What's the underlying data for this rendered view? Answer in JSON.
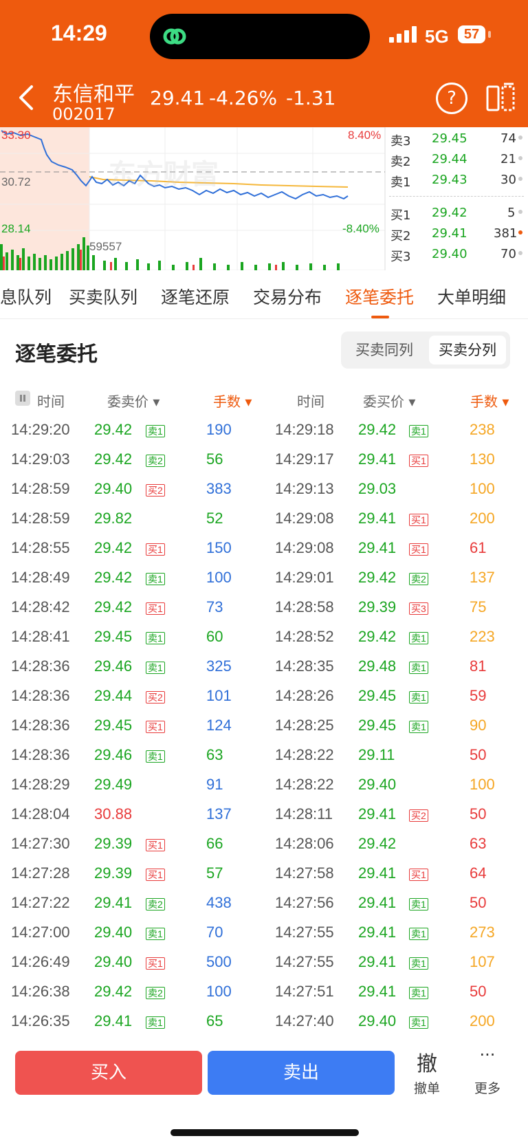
{
  "status": {
    "time": "14:29",
    "network": "5G",
    "battery": "57"
  },
  "stock": {
    "name": "东信和平",
    "code": "002017",
    "price": "29.41",
    "pct": "-4.26%",
    "change": "-1.31"
  },
  "chart": {
    "high": "33.30",
    "mid": "30.72",
    "low": "28.14",
    "up_pct": "8.40%",
    "down_pct": "-8.40%",
    "volume": "59557",
    "watermark": "东方财富"
  },
  "orderbook": {
    "sell": [
      {
        "label": "卖3",
        "price": "29.45",
        "vol": "74"
      },
      {
        "label": "卖2",
        "price": "29.44",
        "vol": "21"
      },
      {
        "label": "卖1",
        "price": "29.43",
        "vol": "30"
      }
    ],
    "buy": [
      {
        "label": "买1",
        "price": "29.42",
        "vol": "5"
      },
      {
        "label": "买2",
        "price": "29.41",
        "vol": "381"
      },
      {
        "label": "买3",
        "price": "29.40",
        "vol": "70"
      }
    ]
  },
  "tabs": [
    "息队列",
    "买卖队列",
    "逐笔还原",
    "交易分布",
    "逐笔委托",
    "大单明细"
  ],
  "section": {
    "title": "逐笔委托",
    "seg_same": "买卖同列",
    "seg_split": "买卖分列"
  },
  "headers": {
    "time1": "时间",
    "sell_price": "委卖价",
    "lots1": "手数",
    "time2": "时间",
    "buy_price": "委买价",
    "lots2": "手数"
  },
  "rows": [
    {
      "lt": "14:29:20",
      "lp": "29.42",
      "lpc": "g",
      "lg": "卖1",
      "lgc": "g",
      "lv": "190",
      "rt": "14:29:18",
      "rp": "29.42",
      "rpc": "g",
      "rg": "卖1",
      "rgc": "g",
      "rv": "238",
      "rvc": "o"
    },
    {
      "lt": "14:29:03",
      "lp": "29.42",
      "lpc": "g",
      "lg": "卖2",
      "lgc": "g",
      "lv": "56",
      "lvc": "g",
      "rt": "14:29:17",
      "rp": "29.41",
      "rpc": "g",
      "rg": "买1",
      "rgc": "r",
      "rv": "130",
      "rvc": "o"
    },
    {
      "lt": "14:28:59",
      "lp": "29.40",
      "lpc": "g",
      "lg": "买2",
      "lgc": "r",
      "lv": "383",
      "rt": "14:29:13",
      "rp": "29.03",
      "rpc": "g",
      "rg": "",
      "rgc": "",
      "rv": "100",
      "rvc": "o"
    },
    {
      "lt": "14:28:59",
      "lp": "29.82",
      "lpc": "g",
      "lg": "",
      "lgc": "",
      "lv": "52",
      "lvc": "g",
      "rt": "14:29:08",
      "rp": "29.41",
      "rpc": "g",
      "rg": "买1",
      "rgc": "r",
      "rv": "200",
      "rvc": "o"
    },
    {
      "lt": "14:28:55",
      "lp": "29.42",
      "lpc": "g",
      "lg": "买1",
      "lgc": "r",
      "lv": "150",
      "rt": "14:29:08",
      "rp": "29.41",
      "rpc": "g",
      "rg": "买1",
      "rgc": "r",
      "rv": "61",
      "rvc": "r"
    },
    {
      "lt": "14:28:49",
      "lp": "29.42",
      "lpc": "g",
      "lg": "卖1",
      "lgc": "g",
      "lv": "100",
      "rt": "14:29:01",
      "rp": "29.42",
      "rpc": "g",
      "rg": "卖2",
      "rgc": "g",
      "rv": "137",
      "rvc": "o"
    },
    {
      "lt": "14:28:42",
      "lp": "29.42",
      "lpc": "g",
      "lg": "买1",
      "lgc": "r",
      "lv": "73",
      "rt": "14:28:58",
      "rp": "29.39",
      "rpc": "g",
      "rg": "买3",
      "rgc": "r",
      "rv": "75",
      "rvc": "o"
    },
    {
      "lt": "14:28:41",
      "lp": "29.45",
      "lpc": "g",
      "lg": "卖1",
      "lgc": "g",
      "lv": "60",
      "lvc": "g",
      "rt": "14:28:52",
      "rp": "29.42",
      "rpc": "g",
      "rg": "卖1",
      "rgc": "g",
      "rv": "223",
      "rvc": "o"
    },
    {
      "lt": "14:28:36",
      "lp": "29.46",
      "lpc": "g",
      "lg": "卖1",
      "lgc": "g",
      "lv": "325",
      "rt": "14:28:35",
      "rp": "29.48",
      "rpc": "g",
      "rg": "卖1",
      "rgc": "g",
      "rv": "81",
      "rvc": "r"
    },
    {
      "lt": "14:28:36",
      "lp": "29.44",
      "lpc": "g",
      "lg": "买2",
      "lgc": "r",
      "lv": "101",
      "rt": "14:28:26",
      "rp": "29.45",
      "rpc": "g",
      "rg": "卖1",
      "rgc": "g",
      "rv": "59",
      "rvc": "r"
    },
    {
      "lt": "14:28:36",
      "lp": "29.45",
      "lpc": "g",
      "lg": "买1",
      "lgc": "r",
      "lv": "124",
      "rt": "14:28:25",
      "rp": "29.45",
      "rpc": "g",
      "rg": "卖1",
      "rgc": "g",
      "rv": "90",
      "rvc": "o"
    },
    {
      "lt": "14:28:36",
      "lp": "29.46",
      "lpc": "g",
      "lg": "卖1",
      "lgc": "g",
      "lv": "63",
      "lvc": "g",
      "rt": "14:28:22",
      "rp": "29.11",
      "rpc": "g",
      "rg": "",
      "rgc": "",
      "rv": "50",
      "rvc": "r"
    },
    {
      "lt": "14:28:29",
      "lp": "29.49",
      "lpc": "g",
      "lg": "",
      "lgc": "",
      "lv": "91",
      "rt": "14:28:22",
      "rp": "29.40",
      "rpc": "g",
      "rg": "",
      "rgc": "",
      "rv": "100",
      "rvc": "o"
    },
    {
      "lt": "14:28:04",
      "lp": "30.88",
      "lpc": "r",
      "lg": "",
      "lgc": "",
      "lv": "137",
      "rt": "14:28:11",
      "rp": "29.41",
      "rpc": "g",
      "rg": "买2",
      "rgc": "r",
      "rv": "50",
      "rvc": "r"
    },
    {
      "lt": "14:27:30",
      "lp": "29.39",
      "lpc": "g",
      "lg": "买1",
      "lgc": "r",
      "lv": "66",
      "lvc": "g",
      "rt": "14:28:06",
      "rp": "29.42",
      "rpc": "g",
      "rg": "",
      "rgc": "",
      "rv": "63",
      "rvc": "r"
    },
    {
      "lt": "14:27:28",
      "lp": "29.39",
      "lpc": "g",
      "lg": "买1",
      "lgc": "r",
      "lv": "57",
      "lvc": "g",
      "rt": "14:27:58",
      "rp": "29.41",
      "rpc": "g",
      "rg": "买1",
      "rgc": "r",
      "rv": "64",
      "rvc": "r"
    },
    {
      "lt": "14:27:22",
      "lp": "29.41",
      "lpc": "g",
      "lg": "卖2",
      "lgc": "g",
      "lv": "438",
      "rt": "14:27:56",
      "rp": "29.41",
      "rpc": "g",
      "rg": "卖1",
      "rgc": "g",
      "rv": "50",
      "rvc": "r"
    },
    {
      "lt": "14:27:00",
      "lp": "29.40",
      "lpc": "g",
      "lg": "卖1",
      "lgc": "g",
      "lv": "70",
      "rt": "14:27:55",
      "rp": "29.41",
      "rpc": "g",
      "rg": "卖1",
      "rgc": "g",
      "rv": "273",
      "rvc": "o"
    },
    {
      "lt": "14:26:49",
      "lp": "29.40",
      "lpc": "g",
      "lg": "买1",
      "lgc": "r",
      "lv": "500",
      "rt": "14:27:55",
      "rp": "29.41",
      "rpc": "g",
      "rg": "卖1",
      "rgc": "g",
      "rv": "107",
      "rvc": "o"
    },
    {
      "lt": "14:26:38",
      "lp": "29.42",
      "lpc": "g",
      "lg": "卖2",
      "lgc": "g",
      "lv": "100",
      "rt": "14:27:51",
      "rp": "29.41",
      "rpc": "g",
      "rg": "卖1",
      "rgc": "g",
      "rv": "50",
      "rvc": "r"
    },
    {
      "lt": "14:26:35",
      "lp": "29.41",
      "lpc": "g",
      "lg": "卖1",
      "lgc": "g",
      "lv": "65",
      "lvc": "g",
      "rt": "14:27:40",
      "rp": "29.40",
      "rpc": "g",
      "rg": "卖1",
      "rgc": "g",
      "rv": "200",
      "rvc": "o"
    }
  ],
  "colors": {
    "g": "#1aa520",
    "r": "#e83a3a",
    "b": "#2f6fd8",
    "o": "#f5a623",
    "brand": "#ee5a0e"
  },
  "actions": {
    "buy": "买入",
    "sell": "卖出",
    "cancel_icon": "撤",
    "cancel": "撤单",
    "more_icon": "···",
    "more": "更多"
  }
}
